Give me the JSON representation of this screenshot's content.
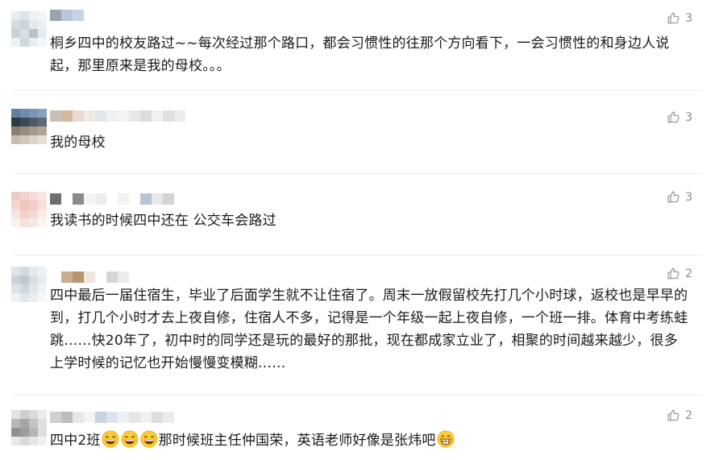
{
  "comments": [
    {
      "text": "桐乡四中的校友路过~~每次经过那个路口，都会习惯性的往那个方向看下，一会习惯性的和身边人说起，那里原来是我的母校。。。",
      "likes": "3"
    },
    {
      "text": "我的母校",
      "likes": "3"
    },
    {
      "text": "我读书的时候四中还在 公交车会路过",
      "likes": "3"
    },
    {
      "text": "四中最后一届住宿生，毕业了后面学生就不让住宿了。周末一放假留校先打几个小时球，返校也是早早的到，打几个小时才去上夜自修，住宿人不多，记得是一个年级一起上夜自修，一个班一排。体育中考练蛙跳……快20年了，初中时的同学还是玩的最好的那批，现在都成家立业了，相聚的时间越来越少，很多上学时候的记忆也开始慢慢变模糊……",
      "likes": "2"
    },
    {
      "text_before": "四中2班",
      "text_after": "那时候班主任仲国荣，英语老师好像是张炜吧",
      "likes": "2"
    }
  ],
  "icons": {
    "like": "thumbs-up-icon",
    "emoji_laugh": "grinning-sweat-emoji",
    "emoji_grin": "grinning-emoji"
  },
  "colors": {
    "text": "#1a1a1a",
    "muted": "#8a8a8a",
    "divider": "#eeeeee"
  }
}
